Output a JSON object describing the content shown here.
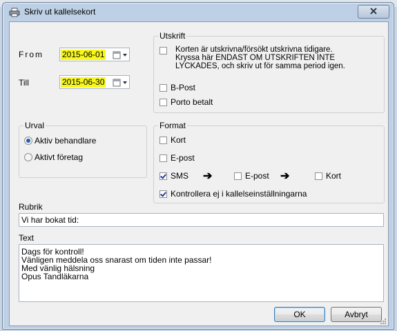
{
  "window": {
    "title": "Skriv ut kallelsekort",
    "close_symbol": "✕"
  },
  "dates": {
    "from_label": "From",
    "from_value": "2015-06-01",
    "till_label": "Till",
    "till_value": "2015-06-30"
  },
  "utskrift": {
    "title": "Utskrift",
    "reprint_label": "Korten är utskrivna/försökt utskrivna tidigare.\nKryssa här ENDAST OM UTSKRIFTEN INTE\nLYCKADES, och skriv ut för samma period igen.",
    "reprint_checked": false,
    "bpost_label": "B-Post",
    "bpost_checked": false,
    "porto_label": "Porto betalt",
    "porto_checked": false
  },
  "urval": {
    "title": "Urval",
    "options": [
      {
        "label": "Aktiv behandlare",
        "selected": true
      },
      {
        "label": "Aktivt företag",
        "selected": false
      }
    ]
  },
  "format": {
    "title": "Format",
    "kort_label": "Kort",
    "kort_checked": false,
    "epost_label": "E-post",
    "epost_checked": false,
    "sms_label": "SMS",
    "sms_checked": true,
    "fallback_epost_label": "E-post",
    "fallback_epost_checked": false,
    "fallback_kort_label": "Kort",
    "fallback_kort_checked": false,
    "arrow": "➔",
    "kontrollera_label": "Kontrollera ej i kallelseinställningarna",
    "kontrollera_checked": true
  },
  "rubrik": {
    "label": "Rubrik",
    "value": "Vi har bokat tid:"
  },
  "text": {
    "label": "Text",
    "value": "Dags för kontroll!\nVänligen meddela oss snarast om tiden inte passar!\nMed vänlig hälsning\nOpus Tandläkarna"
  },
  "buttons": {
    "ok_label": "OK",
    "cancel_label": "Avbryt"
  },
  "colors": {
    "date_highlight": "#f7f71e",
    "dialog_bg": "#f0f0f0",
    "frame": "#bdd0e5"
  }
}
